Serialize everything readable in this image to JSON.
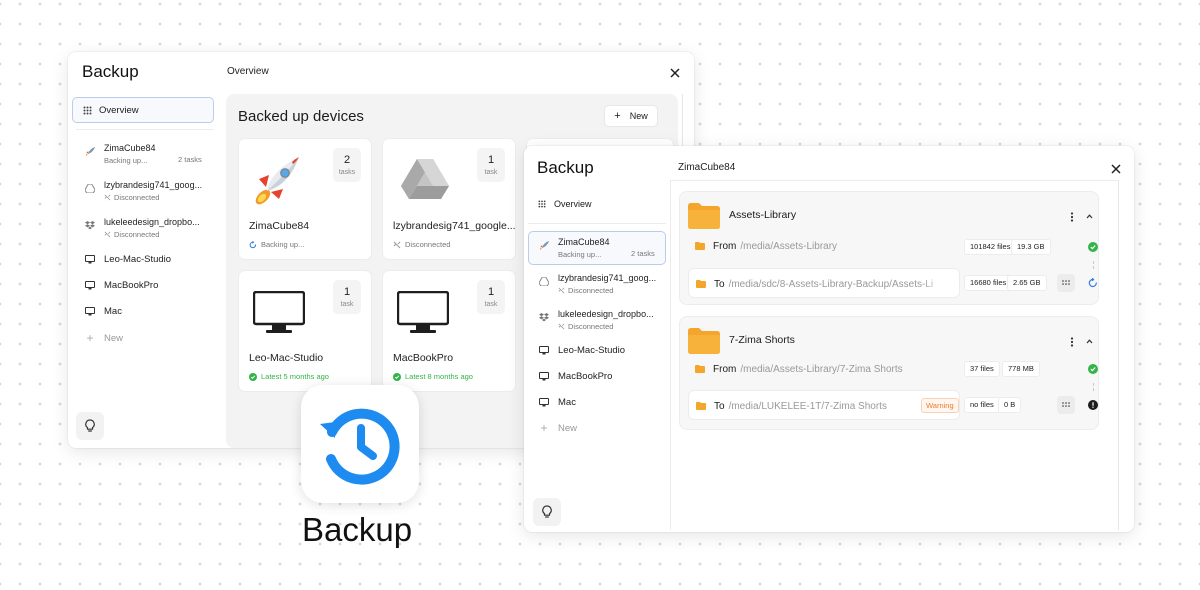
{
  "win1": {
    "app_title": "Backup",
    "breadcrumb": "Overview",
    "nav_overview": "Overview",
    "devices": [
      {
        "name": "ZimaCube84",
        "status": "Backing up...",
        "tasks": "2 tasks",
        "icon": "rocket-icon"
      },
      {
        "name": "lzybrandesig741_goog...",
        "status": "Disconnected",
        "icon": "google-drive-icon"
      },
      {
        "name": "lukeleedesign_dropbo...",
        "status": "Disconnected",
        "icon": "dropbox-icon"
      },
      {
        "name": "Leo-Mac-Studio",
        "icon": "monitor-icon"
      },
      {
        "name": "MacBookPro",
        "icon": "monitor-icon"
      },
      {
        "name": "Mac",
        "icon": "monitor-icon"
      }
    ],
    "nav_new": "New",
    "panel_title": "Backed up devices",
    "new_button": "New",
    "cards": [
      {
        "name": "ZimaCube84",
        "count": "2",
        "count_label": "tasks",
        "status": "Backing up..."
      },
      {
        "name": "lzybrandesig741_google...",
        "count": "1",
        "count_label": "task",
        "status": "Disconnected"
      },
      {
        "name": "Leo-Mac-Studio",
        "count": "1",
        "count_label": "task",
        "status": "Latest 5 months ago"
      },
      {
        "name": "MacBookPro",
        "count": "1",
        "count_label": "task",
        "status": "Latest 8 months ago"
      }
    ]
  },
  "logo": {
    "label": "Backup",
    "accent": "#1e8bf0"
  },
  "win2": {
    "app_title": "Backup",
    "breadcrumb": "ZimaCube84",
    "nav_overview": "Overview",
    "devices": [
      {
        "name": "ZimaCube84",
        "status": "Backing up...",
        "tasks": "2 tasks",
        "icon": "rocket-icon"
      },
      {
        "name": "lzybrandesig741_goog...",
        "status": "Disconnected",
        "icon": "google-drive-icon"
      },
      {
        "name": "lukeleedesign_dropbo...",
        "status": "Disconnected",
        "icon": "dropbox-icon"
      },
      {
        "name": "Leo-Mac-Studio",
        "icon": "monitor-icon"
      },
      {
        "name": "MacBookPro",
        "icon": "monitor-icon"
      },
      {
        "name": "Mac",
        "icon": "monitor-icon"
      }
    ],
    "nav_new": "New",
    "groups": [
      {
        "name": "Assets-Library",
        "from_label": "From",
        "from_path": "/media/Assets-Library",
        "from_files": "101842 files",
        "from_size": "19.3 GB",
        "to_label": "To",
        "to_path": "/media/sdc/8-Assets-Library-Backup/Assets-Li",
        "to_files": "16680 files",
        "to_size": "2.65 GB"
      },
      {
        "name": "7-Zima Shorts",
        "from_label": "From",
        "from_path": "/media/Assets-Library/7-Zima Shorts",
        "from_files": "37 files",
        "from_size": "778 MB",
        "to_label": "To",
        "to_path": "/media/LUKELEE-1T/7-Zima Shorts",
        "to_warning": "Warning",
        "to_files": "no files",
        "to_size": "0 B"
      }
    ]
  },
  "colors": {
    "folder": "#f4a52c",
    "success": "#34b34a",
    "warning": "#ef7b2a",
    "accent": "#2f7de1"
  }
}
